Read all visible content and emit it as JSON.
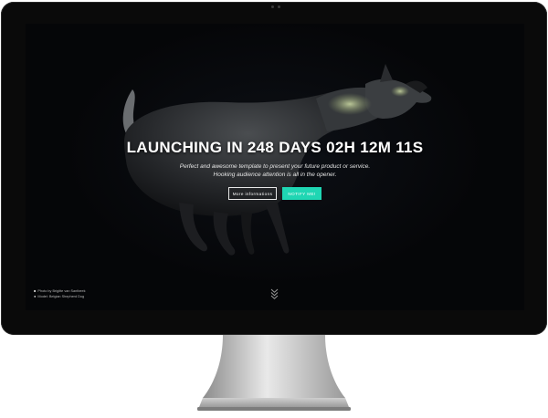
{
  "hero": {
    "title": "LAUNCHING IN 248 DAYS 02H 12M 11S",
    "subtitle_line1": "Perfect and awesome template to present your future product or service.",
    "subtitle_line2": "Hooking audience attention is all in the opener."
  },
  "buttons": {
    "more_info": "More informations",
    "notify": "NOTIFY ME!"
  },
  "credits": {
    "photo": "Photo by Brigitte van Santbeek",
    "model": "Model: Belgian Shepherd Dog"
  },
  "icons": {
    "camera": "camera-icon",
    "info": "info-icon",
    "scroll_down": "chevron-down-icon"
  },
  "colors": {
    "accent": "#1fd6b3",
    "screen_bg": "#050608",
    "bezel": "#0a0a0a"
  }
}
